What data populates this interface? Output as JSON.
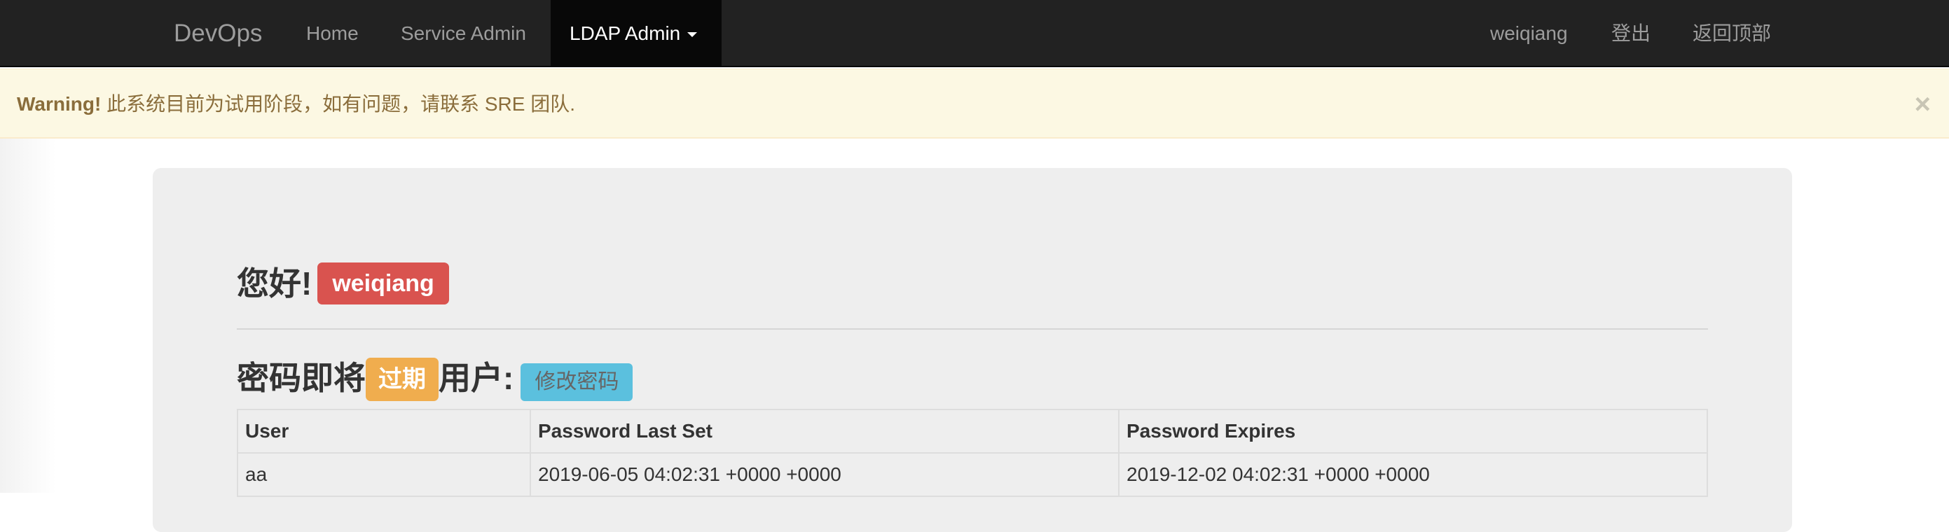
{
  "navbar": {
    "brand": "DevOps",
    "items": [
      {
        "label": "Home"
      },
      {
        "label": "Service Admin"
      },
      {
        "label": "LDAP Admin"
      }
    ],
    "right_items": [
      {
        "label": "weiqiang"
      },
      {
        "label": "登出"
      },
      {
        "label": "返回顶部"
      }
    ]
  },
  "alert": {
    "strong": "Warning!",
    "message": "此系统目前为试用阶段，如有问题，请联系 SRE 团队.",
    "close": "×"
  },
  "greeting": {
    "prefix": "您好!",
    "username": "weiqiang"
  },
  "expire": {
    "part1": "密码即将",
    "badge": "过期",
    "part2": "用户:",
    "button": "修改密码"
  },
  "table": {
    "headers": [
      "User",
      "Password Last Set",
      "Password Expires"
    ],
    "rows": [
      [
        "aa",
        "2019-06-05 04:02:31 +0000 +0000",
        "2019-12-02 04:02:31 +0000 +0000"
      ]
    ]
  },
  "colors": {
    "navbar_bg": "#222222",
    "active_nav_bg": "#080808",
    "alert_bg": "#fcf8e3",
    "alert_text": "#8a6d3b",
    "danger": "#d9534f",
    "warning": "#f0ad4e",
    "info": "#5bc0de",
    "jumbotron_bg": "#eeeeee"
  }
}
